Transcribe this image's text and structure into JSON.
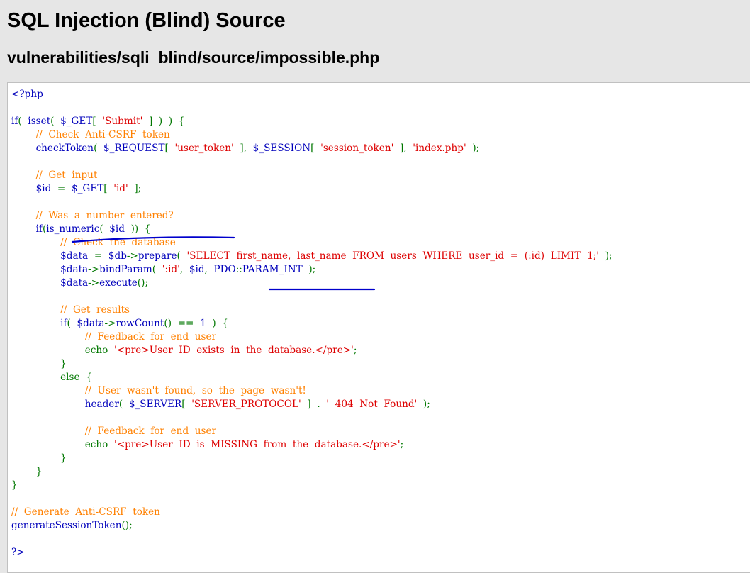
{
  "header": {
    "title": "SQL Injection (Blind) Source",
    "file_path": "vulnerabilities/sqli_blind/source/impossible.php"
  },
  "colors": {
    "page_background": "#e6e6e6",
    "panel_background": "#ffffff",
    "php_default": "#0000bb",
    "php_keyword": "#007700",
    "php_string": "#dd0000",
    "php_comment": "#ff8000",
    "annotation_pen": "#0000cc"
  },
  "code_lines": [
    [
      [
        "t-default",
        "<?php"
      ]
    ],
    [],
    [
      [
        "t-default",
        "if"
      ],
      [
        "t-keyword",
        "(  "
      ],
      [
        "t-default",
        "isset"
      ],
      [
        "t-keyword",
        "(  "
      ],
      [
        "t-default",
        "$_GET"
      ],
      [
        "t-keyword",
        "[  "
      ],
      [
        "t-string",
        "'Submit'"
      ],
      [
        "t-keyword",
        "  ]  )  )  {"
      ]
    ],
    [
      [
        "t-comment",
        "        //  Check  Anti-CSRF  token"
      ]
    ],
    [
      [
        "t-default",
        "        checkToken"
      ],
      [
        "t-keyword",
        "(  "
      ],
      [
        "t-default",
        "$_REQUEST"
      ],
      [
        "t-keyword",
        "[  "
      ],
      [
        "t-string",
        "'user_token'"
      ],
      [
        "t-keyword",
        "  ],  "
      ],
      [
        "t-default",
        "$_SESSION"
      ],
      [
        "t-keyword",
        "[  "
      ],
      [
        "t-string",
        "'session_token'"
      ],
      [
        "t-keyword",
        "  ],  "
      ],
      [
        "t-string",
        "'index.php'"
      ],
      [
        "t-keyword",
        "  );"
      ]
    ],
    [],
    [
      [
        "t-comment",
        "        //  Get  input"
      ]
    ],
    [
      [
        "t-default",
        "        $id  "
      ],
      [
        "t-keyword",
        "=  "
      ],
      [
        "t-default",
        "$_GET"
      ],
      [
        "t-keyword",
        "[  "
      ],
      [
        "t-string",
        "'id'"
      ],
      [
        "t-keyword",
        "  ];"
      ]
    ],
    [],
    [
      [
        "t-comment",
        "        //  Was  a  number  entered?"
      ]
    ],
    [
      [
        "t-keyword",
        "        "
      ],
      [
        "t-default",
        "if"
      ],
      [
        "t-keyword",
        "("
      ],
      [
        "t-default",
        "is_numeric"
      ],
      [
        "t-keyword",
        "(  "
      ],
      [
        "t-default",
        "$id  "
      ],
      [
        "t-keyword",
        "))  {"
      ]
    ],
    [
      [
        "t-comment",
        "                //  Check  the  database"
      ]
    ],
    [
      [
        "t-default",
        "                $data  "
      ],
      [
        "t-keyword",
        "=  "
      ],
      [
        "t-default",
        "$db"
      ],
      [
        "t-keyword",
        "->"
      ],
      [
        "t-default",
        "prepare"
      ],
      [
        "t-keyword",
        "(  "
      ],
      [
        "t-string",
        "'SELECT  first_name,  last_name  FROM  users  WHERE  user_id  =  (:id)  LIMIT  1;'"
      ],
      [
        "t-keyword",
        "  );"
      ]
    ],
    [
      [
        "t-default",
        "                $data"
      ],
      [
        "t-keyword",
        "->"
      ],
      [
        "t-default",
        "bindParam"
      ],
      [
        "t-keyword",
        "(  "
      ],
      [
        "t-string",
        "':id'"
      ],
      [
        "t-keyword",
        ",  "
      ],
      [
        "t-default",
        "$id"
      ],
      [
        "t-keyword",
        ",  "
      ],
      [
        "t-default",
        "PDO"
      ],
      [
        "t-keyword",
        "::"
      ],
      [
        "t-default",
        "PARAM_INT  "
      ],
      [
        "t-keyword",
        ");"
      ]
    ],
    [
      [
        "t-default",
        "                $data"
      ],
      [
        "t-keyword",
        "->"
      ],
      [
        "t-default",
        "execute"
      ],
      [
        "t-keyword",
        "();"
      ]
    ],
    [],
    [
      [
        "t-comment",
        "                //  Get  results"
      ]
    ],
    [
      [
        "t-keyword",
        "                "
      ],
      [
        "t-default",
        "if"
      ],
      [
        "t-keyword",
        "(  "
      ],
      [
        "t-default",
        "$data"
      ],
      [
        "t-keyword",
        "->"
      ],
      [
        "t-default",
        "rowCount"
      ],
      [
        "t-keyword",
        "()  ==  "
      ],
      [
        "t-default",
        "1  "
      ],
      [
        "t-keyword",
        ")  {"
      ]
    ],
    [
      [
        "t-comment",
        "                        //  Feedback  for  end  user"
      ]
    ],
    [
      [
        "t-keyword",
        "                        echo  "
      ],
      [
        "t-string",
        "'<pre>User  ID  exists  in  the  database.</pre>'"
      ],
      [
        "t-keyword",
        ";"
      ]
    ],
    [
      [
        "t-keyword",
        "                }"
      ]
    ],
    [
      [
        "t-keyword",
        "                else  {"
      ]
    ],
    [
      [
        "t-comment",
        "                        //  User  wasn't  found,  so  the  page  wasn't!"
      ]
    ],
    [
      [
        "t-default",
        "                        header"
      ],
      [
        "t-keyword",
        "(  "
      ],
      [
        "t-default",
        "$_SERVER"
      ],
      [
        "t-keyword",
        "[  "
      ],
      [
        "t-string",
        "'SERVER_PROTOCOL'"
      ],
      [
        "t-keyword",
        "  ]  .  "
      ],
      [
        "t-string",
        "'  404  Not  Found'"
      ],
      [
        "t-keyword",
        "  );"
      ]
    ],
    [],
    [
      [
        "t-comment",
        "                        //  Feedback  for  end  user"
      ]
    ],
    [
      [
        "t-keyword",
        "                        echo  "
      ],
      [
        "t-string",
        "'<pre>User  ID  is  MISSING  from  the  database.</pre>'"
      ],
      [
        "t-keyword",
        ";"
      ]
    ],
    [
      [
        "t-keyword",
        "                }"
      ]
    ],
    [
      [
        "t-keyword",
        "        }"
      ]
    ],
    [
      [
        "t-keyword",
        "}"
      ]
    ],
    [],
    [
      [
        "t-comment",
        "//  Generate  Anti-CSRF  token"
      ]
    ],
    [
      [
        "t-default",
        "generateSessionToken"
      ],
      [
        "t-keyword",
        "();"
      ]
    ],
    [],
    [
      [
        "t-default",
        "?>"
      ]
    ]
  ]
}
